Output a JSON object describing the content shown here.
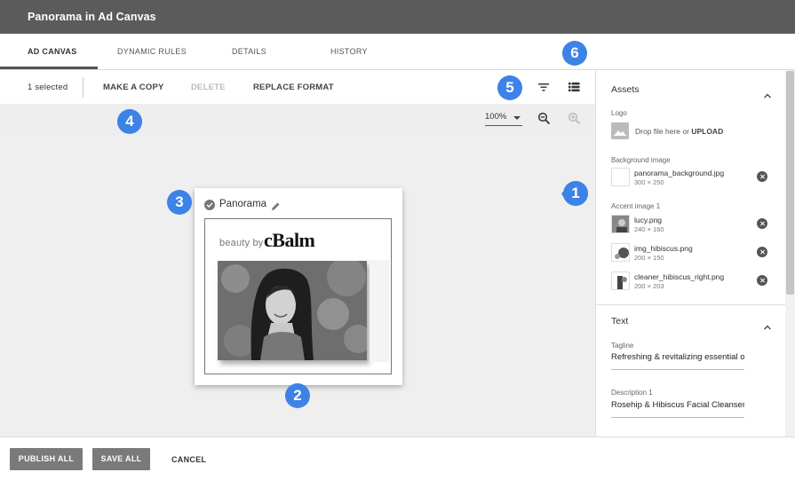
{
  "app": {
    "title": "Panorama in Ad Canvas"
  },
  "tabs": [
    {
      "label": "AD CANVAS"
    },
    {
      "label": "DYNAMIC RULES"
    },
    {
      "label": "DETAILS"
    },
    {
      "label": "HISTORY"
    }
  ],
  "toolbar": {
    "selected_count": "1 selected",
    "make_copy": "MAKE A COPY",
    "delete": "DELETE",
    "replace_format": "REPLACE FORMAT"
  },
  "zoom": {
    "level": "100%"
  },
  "card": {
    "title": "Panorama",
    "ad_tagline_prefix": "beauty by",
    "ad_brand": "cBalm"
  },
  "markers": [
    "1",
    "2",
    "3",
    "4",
    "5",
    "6"
  ],
  "panel": {
    "assets_title": "Assets",
    "logo_label": "Logo",
    "drop_text": "Drop file here or ",
    "upload_label": "UPLOAD",
    "background_label": "Background image",
    "background_asset": {
      "name": "panorama_background.jpg",
      "dim": "300 × 250"
    },
    "accent_label": "Accent image 1",
    "accent_assets": [
      {
        "name": "lucy.png",
        "dim": "240 × 160"
      },
      {
        "name": "img_hibiscus.png",
        "dim": "200 × 150"
      },
      {
        "name": "cleaner_hibiscus_right.png",
        "dim": "200 × 203"
      }
    ],
    "text_title": "Text",
    "tagline_label": "Tagline",
    "tagline_value": "Refreshing & revitalizing essential oils",
    "description_label": "Description 1",
    "description_value": "Rosehip & Hibiscus Facial Cleanser"
  },
  "footer": {
    "publish_all": "PUBLISH ALL",
    "save_all": "SAVE ALL",
    "cancel": "CANCEL"
  },
  "colors": {
    "header_bg": "#5b5b5b",
    "marker_blue": "#3d82e6",
    "footer_button": "#7a7a7a"
  },
  "icons": [
    "filter-icon",
    "list-view-icon",
    "zoom-out-icon",
    "zoom-in-icon",
    "edit-pencil-icon",
    "check-circle-icon",
    "image-placeholder-icon",
    "remove-icon",
    "chevron-up-icon"
  ]
}
